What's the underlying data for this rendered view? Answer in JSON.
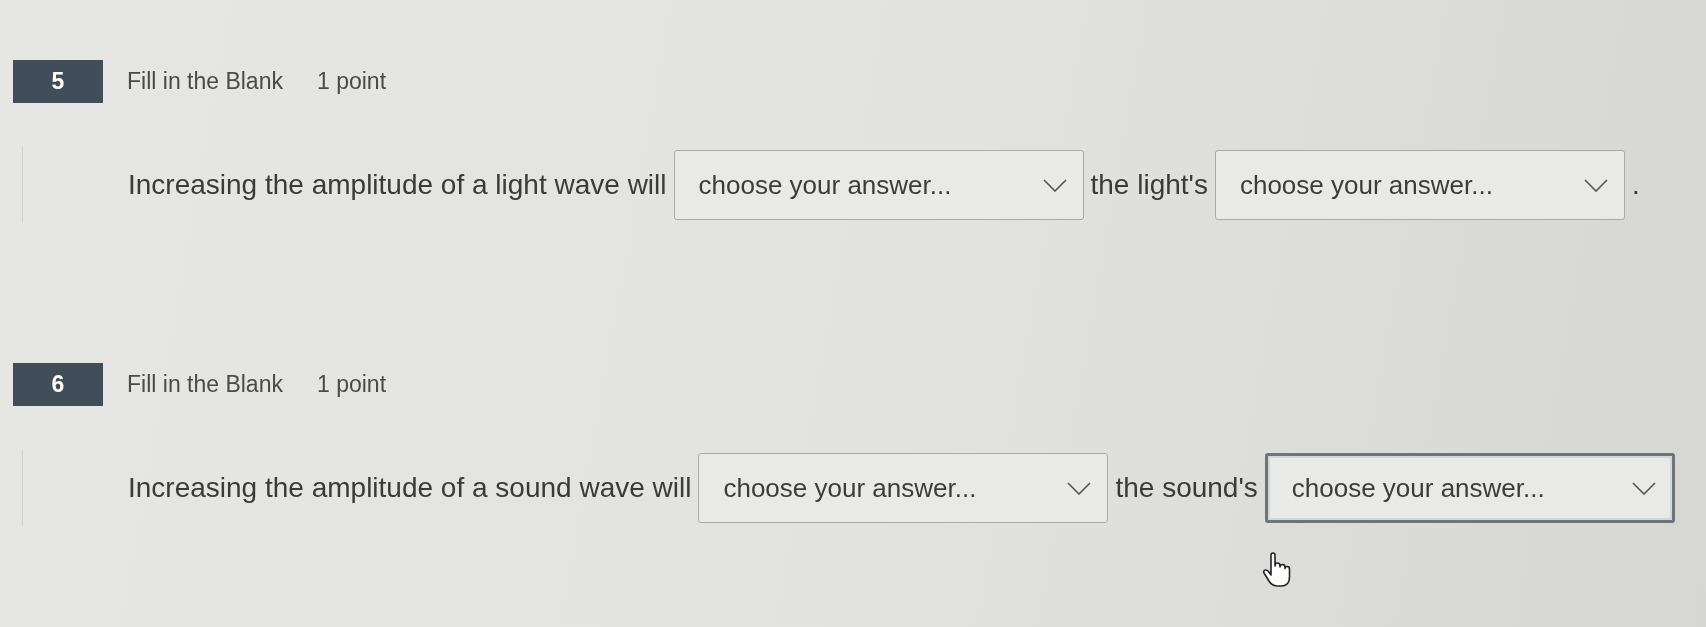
{
  "questions": [
    {
      "number": "5",
      "type": "Fill in the Blank",
      "points": "1 point",
      "parts": [
        {
          "kind": "text",
          "text": "Increasing the amplitude of a light wave will"
        },
        {
          "kind": "dropdown",
          "placeholder": "choose your answer...",
          "focused": false
        },
        {
          "kind": "text",
          "text": "the light's"
        },
        {
          "kind": "dropdown",
          "placeholder": "choose your answer...",
          "focused": false
        },
        {
          "kind": "text",
          "text": "."
        }
      ]
    },
    {
      "number": "6",
      "type": "Fill in the Blank",
      "points": "1 point",
      "parts": [
        {
          "kind": "text",
          "text": "Increasing the amplitude of a sound wave will"
        },
        {
          "kind": "dropdown",
          "placeholder": "choose your answer...",
          "focused": false
        },
        {
          "kind": "text",
          "text": "the sound's"
        },
        {
          "kind": "dropdown",
          "placeholder": "choose your answer...",
          "focused": true
        }
      ]
    }
  ]
}
